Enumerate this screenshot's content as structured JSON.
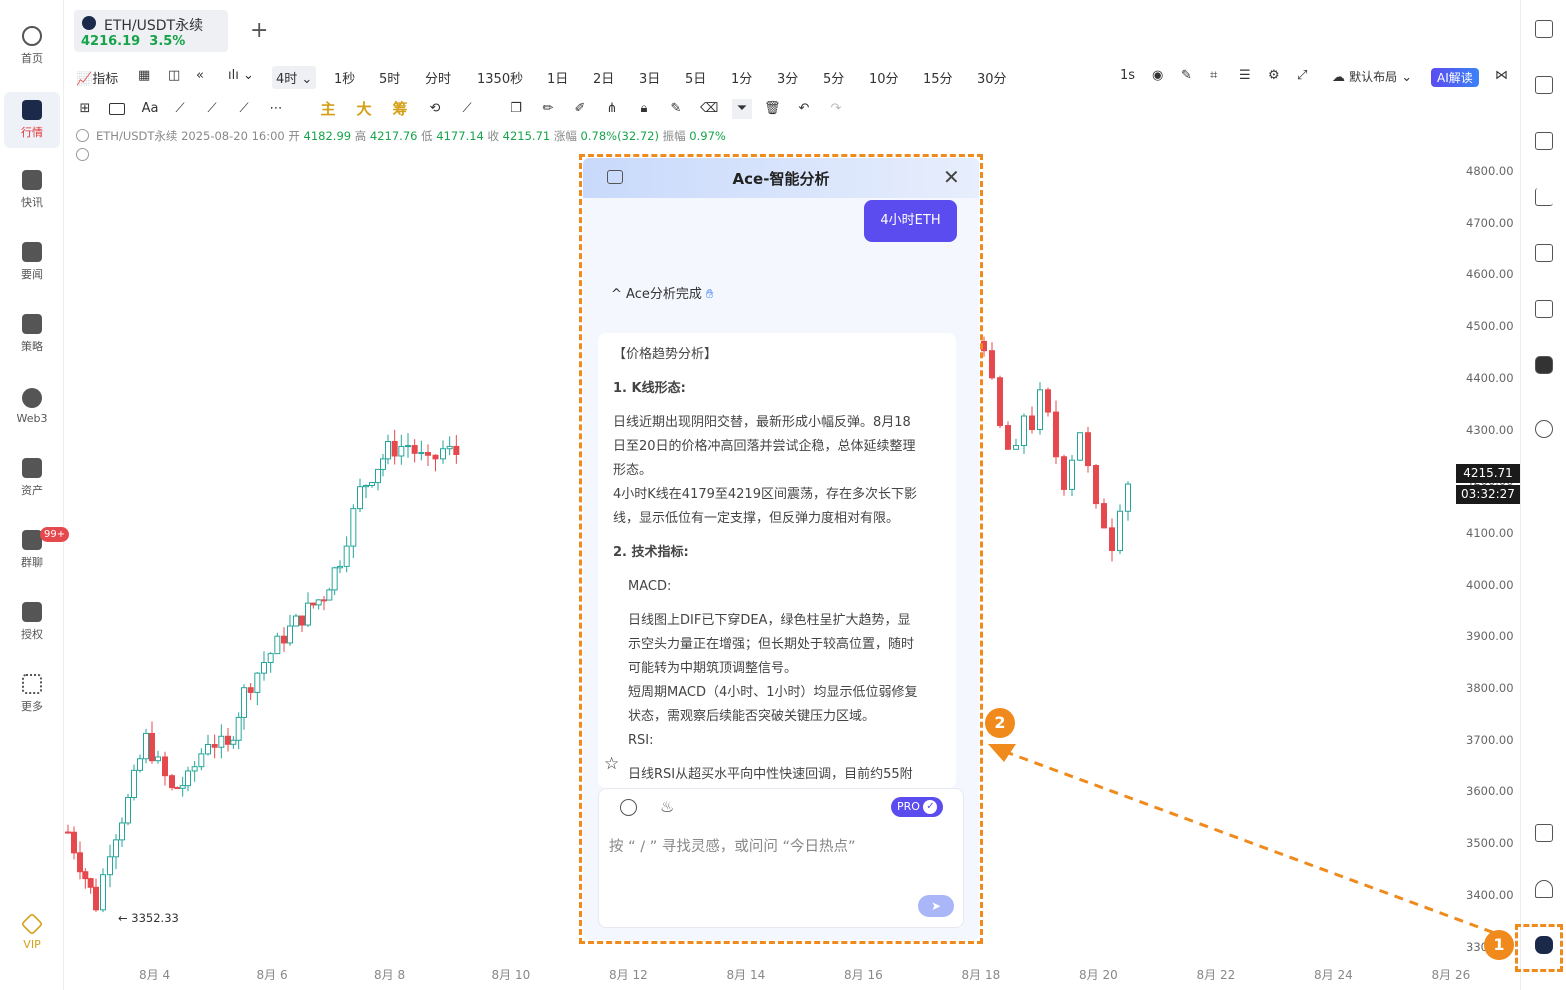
{
  "sidebar": {
    "items": [
      {
        "label": "首页",
        "icon": "home-icon"
      },
      {
        "label": "行情",
        "icon": "market-icon"
      },
      {
        "label": "快讯",
        "icon": "flash-news-icon"
      },
      {
        "label": "要闻",
        "icon": "news-icon"
      },
      {
        "label": "策略",
        "icon": "strategy-icon"
      },
      {
        "label": "Web3",
        "icon": "web3-icon"
      },
      {
        "label": "资产",
        "icon": "wallet-icon"
      },
      {
        "label": "群聊",
        "icon": "chat-icon"
      },
      {
        "label": "授权",
        "icon": "auth-icon"
      },
      {
        "label": "更多",
        "icon": "more-icon"
      }
    ],
    "chat_badge": "99+",
    "vip_label": "VIP"
  },
  "tab": {
    "title": "ETH/USDT永续",
    "price": "4216.19",
    "change": "3.5%"
  },
  "toolbar": {
    "indicator_label": "指标",
    "intervals": [
      "4时",
      "1秒",
      "5时",
      "分时",
      "1350秒",
      "1日",
      "2日",
      "3日",
      "5日",
      "1分",
      "3分",
      "5分",
      "10分",
      "15分",
      "30分"
    ],
    "selected_interval": "4时",
    "realtime": "1s",
    "layout_label": "默认布局",
    "ai_label": "AI解读"
  },
  "drawing_tools": {
    "main": "主",
    "big": "大",
    "chip": "筹",
    "text": "Aa"
  },
  "info_line": {
    "symbol": "ETH/USDT永续",
    "time": "2025-08-20 16:00",
    "open_label": "开",
    "open": "4182.99",
    "high_label": "高",
    "high": "4217.76",
    "low_label": "低",
    "low": "4177.14",
    "close_label": "收",
    "close": "4215.71",
    "change_label": "涨幅",
    "change": "0.78%(32.72)",
    "amp_label": "振幅",
    "amp": "0.97%"
  },
  "chart": {
    "y_labels": [
      "4800.00",
      "4700.00",
      "4600.00",
      "4500.00",
      "4400.00",
      "4300.00",
      "4200.00",
      "4100.00",
      "4000.00",
      "3900.00",
      "3800.00",
      "3700.00",
      "3600.00",
      "3500.00",
      "3400.00",
      "330"
    ],
    "x_labels": [
      "8月 4",
      "8月 6",
      "8月 8",
      "8月 10",
      "8月 12",
      "8月 14",
      "8月 16",
      "8月 18",
      "8月 20",
      "8月 22",
      "8月 24",
      "8月 26"
    ],
    "current_price": "4215.71",
    "countdown": "03:32:27",
    "low_marker": "← 3352.33",
    "up_color": "#26a69a",
    "down_color": "#e5484d"
  },
  "dialog": {
    "title": "Ace-智能分析",
    "user_message": "4小时ETH",
    "status": "Ace分析完成",
    "section_title": "【价格趋势分析】",
    "kline_title": "1. K线形态:",
    "kline_p1": "日线近期出现阴阳交替，最新形成小幅反弹。8月18",
    "kline_p2": "日至20日的价格冲高回落并尝试企稳，总体延续整理",
    "kline_p3": "形态。",
    "kline_p4": "4小时K线在4179至4219区间震荡，存在多次长下影",
    "kline_p5": "线，显示低位有一定支撑，但反弹力度相对有限。",
    "tech_title": "2. 技术指标:",
    "macd_title": "MACD:",
    "macd_p1": "日线图上DIF已下穿DEA，绿色柱呈扩大趋势，显",
    "macd_p2": "示空头力量正在增强；但长期处于较高位置，随时",
    "macd_p3": "可能转为中期筑顶调整信号。",
    "macd_p4": "短周期MACD（4小时、1小时）均显示低位弱修复",
    "macd_p5": "状态，需观察后续能否突破关键压力区域。",
    "rsi_title": "RSI:",
    "rsi_p1": "日线RSI从超买水平向中性快速回调，目前约55附",
    "pro_label": "PRO",
    "input_placeholder": "按 “ / ” 寻找灵感，或问问 “今日热点”"
  },
  "annotations": {
    "marker1": "1",
    "marker2": "2",
    "accent": "#f08a1c"
  }
}
